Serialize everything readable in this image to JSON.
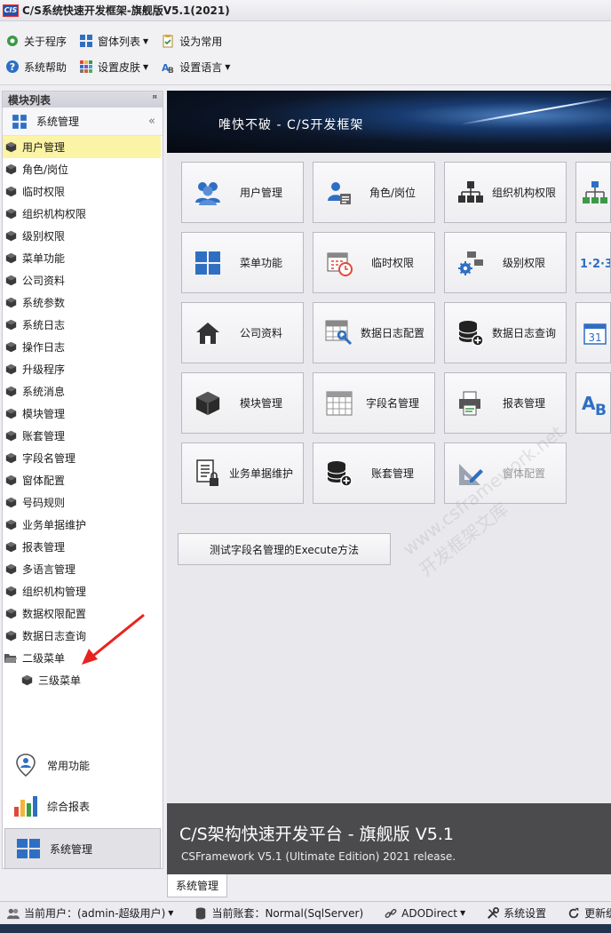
{
  "window": {
    "title": "C/S系统快速开发框架-旗舰版V5.1(2021)",
    "logo_text": "CIS"
  },
  "toolbar": {
    "row1": [
      {
        "label": "关于程序",
        "icon": "gear-icon",
        "caret": false
      },
      {
        "label": "窗体列表",
        "icon": "windows-icon",
        "caret": true
      },
      {
        "label": "设为常用",
        "icon": "clipboard-check-icon",
        "caret": false
      }
    ],
    "row2": [
      {
        "label": "系统帮助",
        "icon": "help-icon",
        "caret": false
      },
      {
        "label": "设置皮肤",
        "icon": "palette-grid-icon",
        "caret": true
      },
      {
        "label": "设置语言",
        "icon": "language-icon",
        "caret": true
      }
    ]
  },
  "left_panel": {
    "title": "模块列表",
    "group": "系统管理",
    "tree": [
      "用户管理",
      "角色/岗位",
      "临时权限",
      "组织机构权限",
      "级别权限",
      "菜单功能",
      "公司资料",
      "系统参数",
      "系统日志",
      "操作日志",
      "升级程序",
      "系统消息",
      "模块管理",
      "账套管理",
      "字段名管理",
      "窗体配置",
      "号码规则",
      "业务单据维护",
      "报表管理",
      "多语言管理",
      "组织机构管理",
      "数据权限配置",
      "数据日志查询"
    ],
    "selected": "用户管理",
    "folder": "二级菜单",
    "subitem": "三级菜单",
    "nav": [
      {
        "label": "常用功能",
        "icon": "user-pin-icon"
      },
      {
        "label": "综合报表",
        "icon": "bar-chart-icon"
      },
      {
        "label": "系统管理",
        "icon": "windows-icon"
      }
    ]
  },
  "main": {
    "banner_text": "唯快不破 - C/S开发框架",
    "tiles": [
      {
        "label": "用户管理",
        "icon": "users-icon"
      },
      {
        "label": "角色/岗位",
        "icon": "user-card-icon"
      },
      {
        "label": "组织机构权限",
        "icon": "org-chart-icon"
      },
      {
        "label": "",
        "icon": "org-tree-icon"
      },
      {
        "label": "菜单功能",
        "icon": "windows-icon"
      },
      {
        "label": "临时权限",
        "icon": "calendar-clock-icon"
      },
      {
        "label": "级别权限",
        "icon": "gear-blocks-icon"
      },
      {
        "label": "",
        "icon": "numbers-icon"
      },
      {
        "label": "公司资料",
        "icon": "home-icon"
      },
      {
        "label": "数据日志配置",
        "icon": "table-wrench-icon"
      },
      {
        "label": "数据日志查询",
        "icon": "database-add-icon"
      },
      {
        "label": "",
        "icon": "calendar-31-icon"
      },
      {
        "label": "模块管理",
        "icon": "cube-icon"
      },
      {
        "label": "字段名管理",
        "icon": "table-grid-icon"
      },
      {
        "label": "报表管理",
        "icon": "printer-icon"
      },
      {
        "label": "",
        "icon": "ab-text-icon"
      },
      {
        "label": "业务单据维护",
        "icon": "document-lock-icon"
      },
      {
        "label": "账套管理",
        "icon": "database-add-icon"
      },
      {
        "label": "窗体配置",
        "icon": "ruler-pencil-icon"
      }
    ],
    "test_button": "测试字段名管理的Execute方法",
    "footer_title": "C/S架构快速开发平台 - 旗舰版 V5.1",
    "footer_subtitle": "CSFramework V5.1 (Ultimate Edition) 2021 release.",
    "watermark_line1": "www.csframework.net",
    "watermark_line2": "开发框架文库"
  },
  "doc_tab": "系统管理",
  "status": [
    {
      "label": "当前用户：(admin-超级用户)",
      "icon": "users-icon",
      "caret": true
    },
    {
      "label": "当前账套：Normal(SqlServer)",
      "icon": "database-icon",
      "caret": false
    },
    {
      "label": "ADODirect",
      "icon": "link-icon",
      "caret": true
    },
    {
      "label": "系统设置",
      "icon": "tools-icon",
      "caret": false
    },
    {
      "label": "更新缓存数",
      "icon": "refresh-icon",
      "caret": false
    }
  ],
  "colors": {
    "accent_blue": "#2f6fc3",
    "selected_row": "#fbf3a6",
    "footer_bg": "#4b4b4d"
  }
}
